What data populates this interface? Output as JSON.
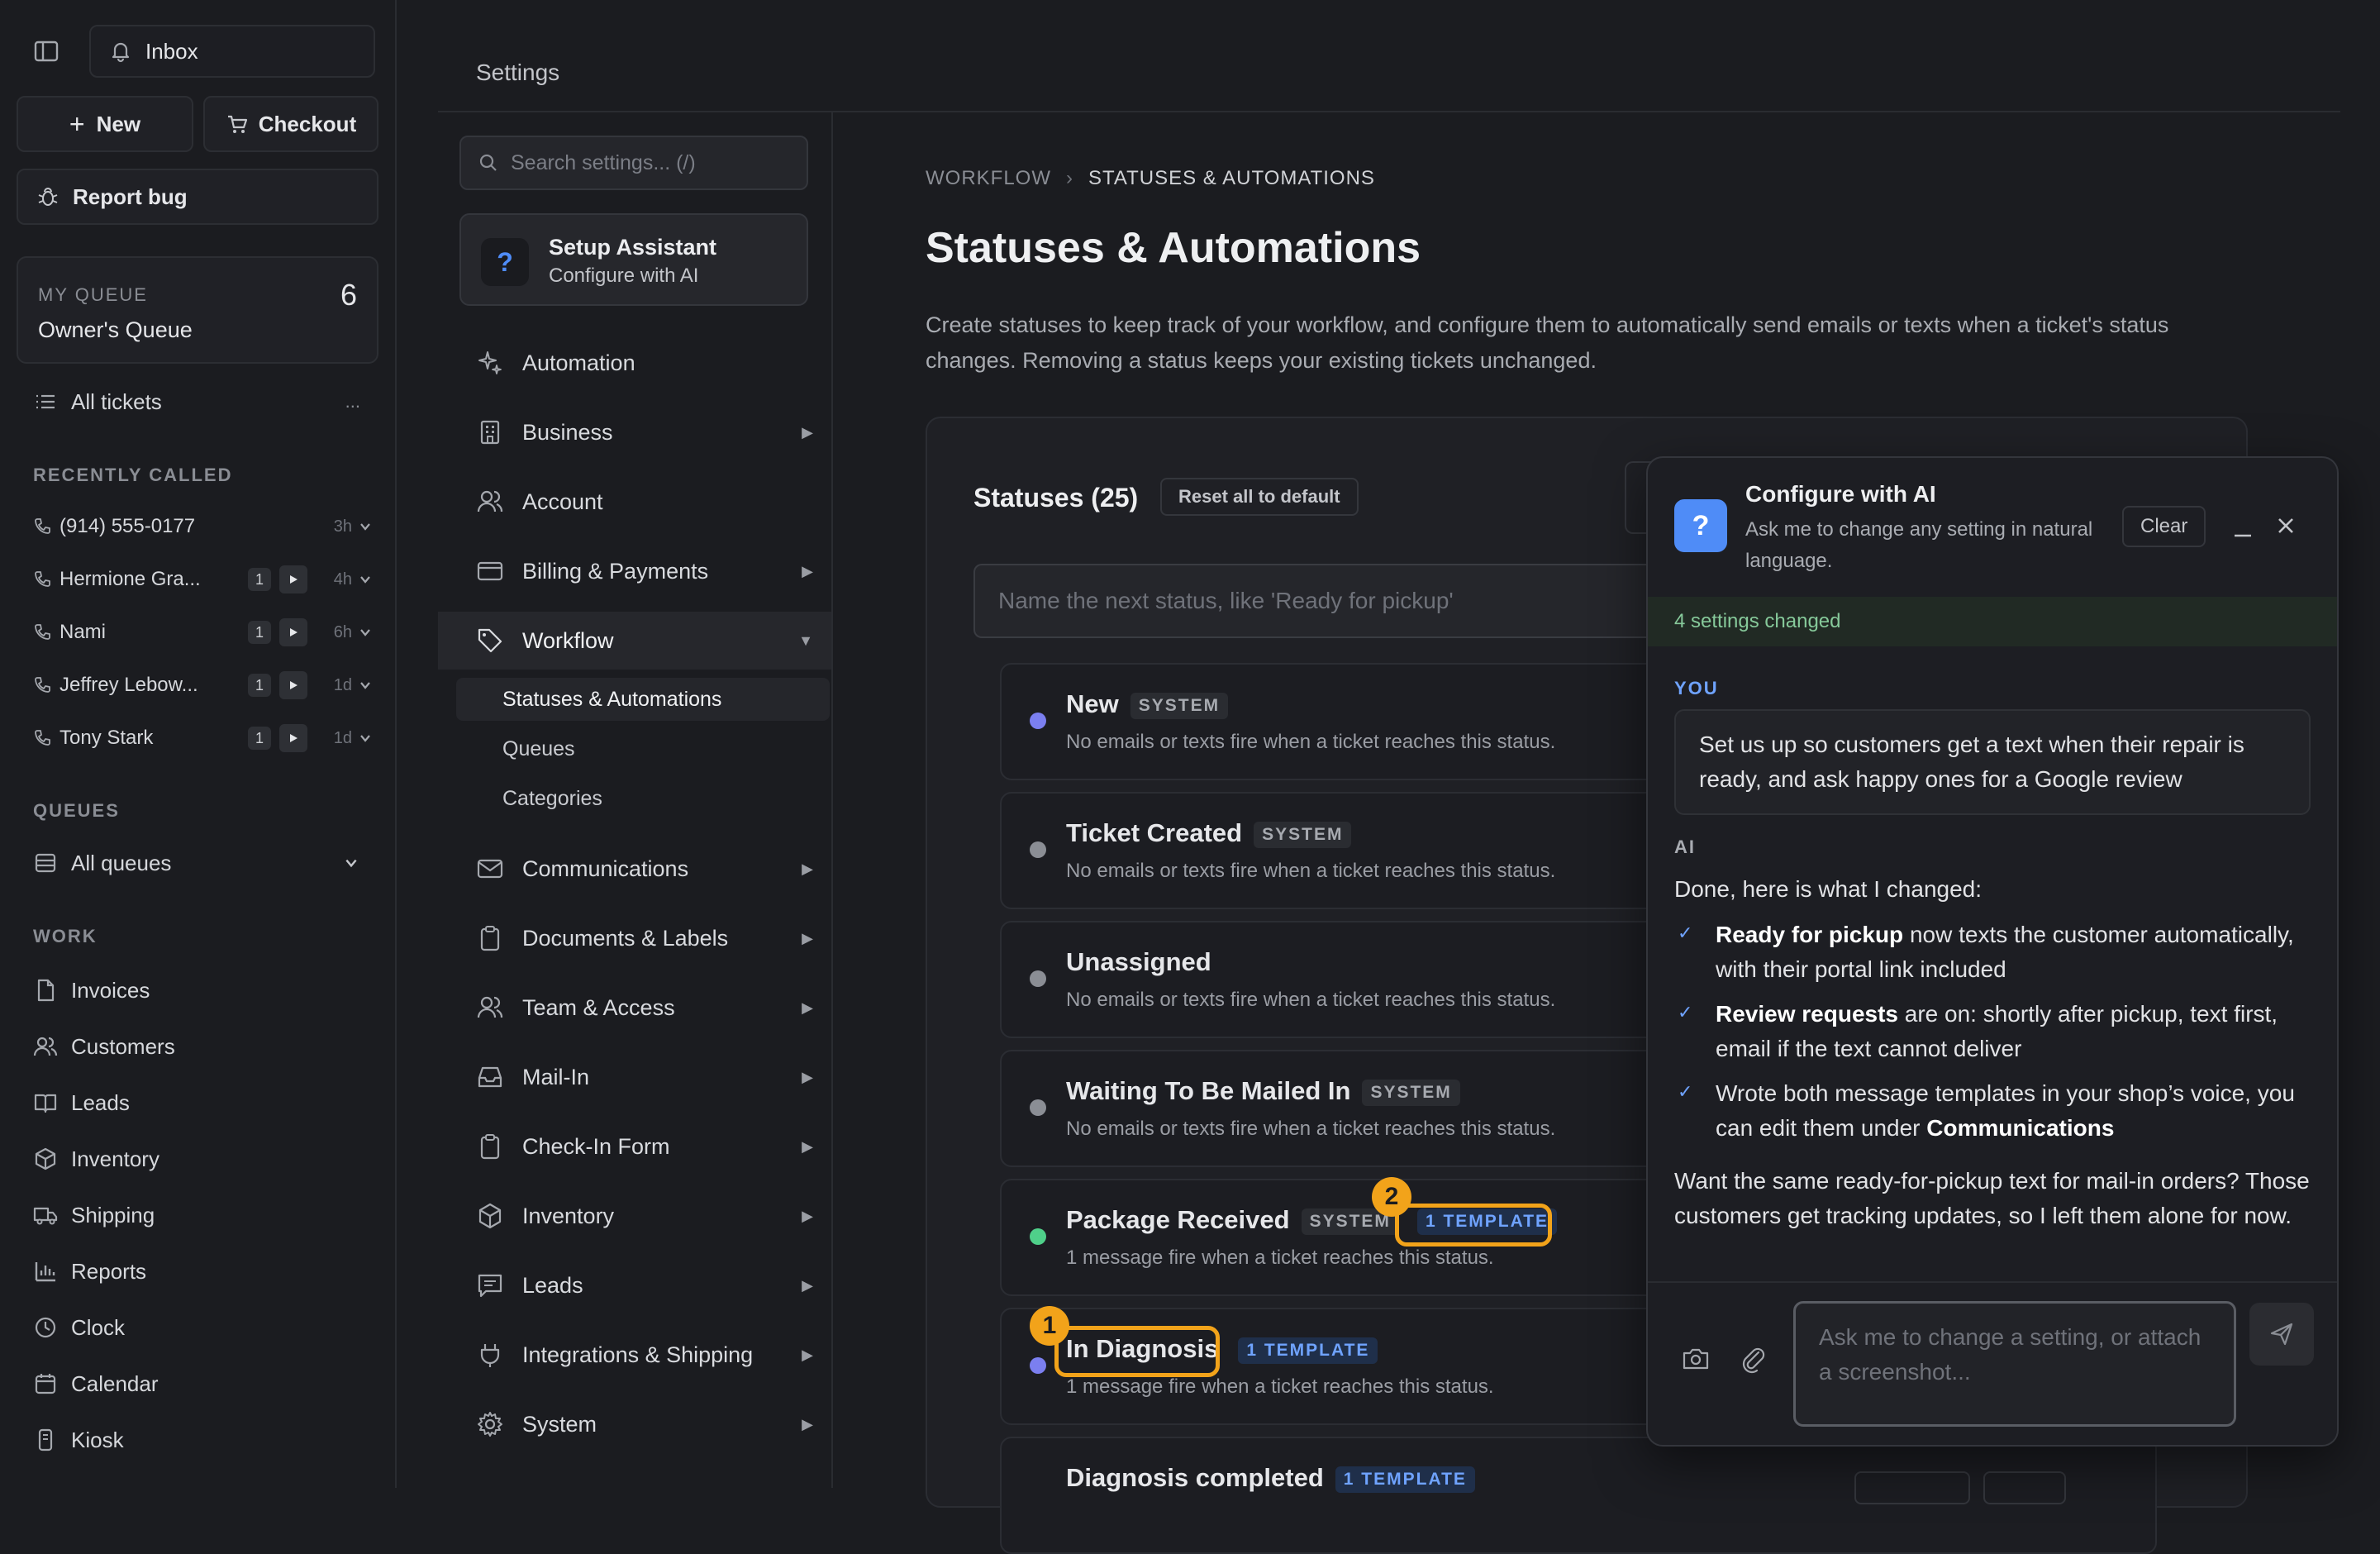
{
  "sidebar": {
    "inbox_label": "Inbox",
    "new_label": "New",
    "checkout_label": "Checkout",
    "report_bug_label": "Report bug",
    "queue": {
      "heading": "MY QUEUE",
      "name": "Owner's Queue",
      "count": "6"
    },
    "all_tickets_label": "All tickets",
    "all_tickets_more": "...",
    "recently_called_heading": "RECENTLY CALLED",
    "calls": [
      {
        "name": "(914) 555-0177",
        "badge": "",
        "ago": "3h"
      },
      {
        "name": "Hermione Gra...",
        "badge": "1",
        "ago": "4h"
      },
      {
        "name": "Nami",
        "badge": "1",
        "ago": "6h"
      },
      {
        "name": "Jeffrey Lebow...",
        "badge": "1",
        "ago": "1d"
      },
      {
        "name": "Tony Stark",
        "badge": "1",
        "ago": "1d"
      }
    ],
    "queues_heading": "QUEUES",
    "all_queues_label": "All queues",
    "work_heading": "WORK",
    "work_items": [
      "Invoices",
      "Customers",
      "Leads",
      "Inventory",
      "Shipping",
      "Reports",
      "Clock",
      "Calendar",
      "Kiosk"
    ]
  },
  "settings": {
    "title": "Settings",
    "search_placeholder": "Search settings... (/)",
    "assistant": {
      "title": "Setup Assistant",
      "subtitle": "Configure with AI"
    },
    "nav": [
      "Automation",
      "Business",
      "Account",
      "Billing & Payments",
      "Workflow",
      "Communications",
      "Documents & Labels",
      "Team & Access",
      "Mail-In",
      "Check-In Form",
      "Inventory",
      "Leads",
      "Integrations & Shipping",
      "System"
    ],
    "workflow_sub": [
      "Statuses & Automations",
      "Queues",
      "Categories"
    ]
  },
  "main": {
    "breadcrumb": [
      "WORKFLOW",
      "STATUSES & AUTOMATIONS"
    ],
    "breadcrumb_sep": "›",
    "title": "Statuses & Automations",
    "description": "Create statuses to keep track of your workflow, and configure them to automatically send emails or texts when a ticket's status changes. Removing a status keeps your existing tickets unchanged.",
    "statuses_heading": "Statuses (25)",
    "reset_label": "Reset all to default",
    "new_status_placeholder": "Name the next status, like 'Ready for pickup'",
    "statuses": [
      {
        "name": "New",
        "tag": "SYSTEM",
        "tpl": "",
        "desc": "No emails or texts fire when a ticket reaches this status.",
        "color": "#7b7ff0"
      },
      {
        "name": "Ticket Created",
        "tag": "SYSTEM",
        "tpl": "",
        "desc": "No emails or texts fire when a ticket reaches this status.",
        "color": "#8b8e95"
      },
      {
        "name": "Unassigned",
        "tag": "",
        "tpl": "",
        "desc": "No emails or texts fire when a ticket reaches this status.",
        "color": "#8b8e95"
      },
      {
        "name": "Waiting To Be Mailed In",
        "tag": "SYSTEM",
        "tpl": "",
        "desc": "No emails or texts fire when a ticket reaches this status.",
        "color": "#8b8e95"
      },
      {
        "name": "Package Received",
        "tag": "SYSTEM",
        "tpl": "1 TEMPLATE",
        "desc": "1 message fire when a ticket reaches this status.",
        "color": "#4fd08a"
      },
      {
        "name": "In Diagnosis",
        "tag": "",
        "tpl": "1 TEMPLATE",
        "desc": "1 message fire when a ticket reaches this status.",
        "color": "#7b7ff0"
      },
      {
        "name": "Diagnosis completed",
        "tag": "",
        "tpl": "1 TEMPLATE",
        "desc": "",
        "color": "#8b8e95"
      }
    ],
    "callouts": [
      "1",
      "2"
    ]
  },
  "ai": {
    "title": "Configure with AI",
    "subtitle": "Ask me to change any setting in natural language.",
    "clear_label": "Clear",
    "changed_banner": "4 settings changed",
    "you_label": "YOU",
    "user_message": "Set us up so customers get a text when their repair is ready, and ask happy ones for a Google review",
    "ai_label": "AI",
    "intro": "Done, here is what I changed:",
    "bullets": [
      {
        "bold": "Ready for pickup",
        "text": " now texts the customer automatically, with their portal link included"
      },
      {
        "bold": "Review requests",
        "text": " are on: shortly after pickup, text first, email if the text cannot deliver"
      },
      {
        "pre": "Wrote both message templates in your shop’s voice, you can edit them under ",
        "bold": "Communications"
      }
    ],
    "followup": "Want the same ready-for-pickup text for mail-in orders? Those customers get tracking updates, so I left them alone for now.",
    "input_placeholder": "Ask me to change a setting, or attach a screenshot..."
  }
}
